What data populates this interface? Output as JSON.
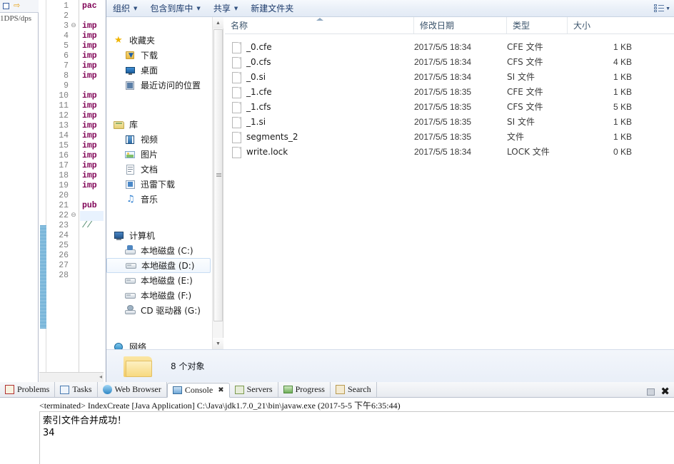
{
  "ide": {
    "breadcrumb": "1DPS/dps",
    "left_tab_icons": [
      "package-explorer-icon",
      "forward-arrow-icon"
    ],
    "editor": {
      "lines": [
        {
          "no": "1",
          "text": "pac",
          "kind": "kw",
          "fold": ""
        },
        {
          "no": "2",
          "text": "",
          "kind": "",
          "fold": ""
        },
        {
          "no": "3",
          "text": "imp",
          "kind": "kw",
          "fold": "⊖"
        },
        {
          "no": "4",
          "text": "imp",
          "kind": "kw",
          "fold": ""
        },
        {
          "no": "5",
          "text": "imp",
          "kind": "kw",
          "fold": ""
        },
        {
          "no": "6",
          "text": "imp",
          "kind": "kw",
          "fold": ""
        },
        {
          "no": "7",
          "text": "imp",
          "kind": "kw",
          "fold": ""
        },
        {
          "no": "8",
          "text": "imp",
          "kind": "kw",
          "fold": ""
        },
        {
          "no": "9",
          "text": "",
          "kind": "",
          "fold": ""
        },
        {
          "no": "10",
          "text": "imp",
          "kind": "kw",
          "fold": ""
        },
        {
          "no": "11",
          "text": "imp",
          "kind": "kw",
          "fold": ""
        },
        {
          "no": "12",
          "text": "imp",
          "kind": "kw",
          "fold": ""
        },
        {
          "no": "13",
          "text": "imp",
          "kind": "kw",
          "fold": ""
        },
        {
          "no": "14",
          "text": "imp",
          "kind": "kw",
          "fold": ""
        },
        {
          "no": "15",
          "text": "imp",
          "kind": "kw",
          "fold": ""
        },
        {
          "no": "16",
          "text": "imp",
          "kind": "kw",
          "fold": ""
        },
        {
          "no": "17",
          "text": "imp",
          "kind": "kw",
          "fold": ""
        },
        {
          "no": "18",
          "text": "imp",
          "kind": "kw",
          "fold": ""
        },
        {
          "no": "19",
          "text": "imp",
          "kind": "kw",
          "fold": ""
        },
        {
          "no": "20",
          "text": "",
          "kind": "",
          "fold": ""
        },
        {
          "no": "21",
          "text": "pub",
          "kind": "kw",
          "fold": ""
        },
        {
          "no": "22",
          "text": "",
          "kind": "",
          "fold": "⊖"
        },
        {
          "no": "23",
          "text": "//",
          "kind": "cmt",
          "fold": ""
        },
        {
          "no": "24",
          "text": "",
          "kind": "",
          "fold": ""
        },
        {
          "no": "25",
          "text": "",
          "kind": "",
          "fold": ""
        },
        {
          "no": "26",
          "text": "",
          "kind": "",
          "fold": ""
        },
        {
          "no": "27",
          "text": "",
          "kind": "",
          "fold": ""
        },
        {
          "no": "28",
          "text": "",
          "kind": "",
          "fold": ""
        }
      ]
    }
  },
  "explorer": {
    "toolbar": {
      "items": [
        {
          "label": "组织",
          "has_caret": true
        },
        {
          "label": "包含到库中",
          "has_caret": true
        },
        {
          "label": "共享",
          "has_caret": true
        },
        {
          "label": "新建文件夹",
          "has_caret": false
        }
      ],
      "view_caret": "▼"
    },
    "nav": {
      "groups": [
        {
          "label": "收藏夹",
          "icon": "star-icon",
          "children": [
            {
              "label": "下载",
              "icon": "downloads-icon"
            },
            {
              "label": "桌面",
              "icon": "desktop-icon"
            },
            {
              "label": "最近访问的位置",
              "icon": "recent-places-icon"
            }
          ]
        },
        {
          "label": "库",
          "icon": "library-icon",
          "children": [
            {
              "label": "视频",
              "icon": "video-icon"
            },
            {
              "label": "图片",
              "icon": "pictures-icon"
            },
            {
              "label": "文档",
              "icon": "documents-icon"
            },
            {
              "label": "迅雷下载",
              "icon": "thunder-download-icon"
            },
            {
              "label": "音乐",
              "icon": "music-icon"
            }
          ]
        },
        {
          "label": "计算机",
          "icon": "computer-icon",
          "children": [
            {
              "label": "本地磁盘 (C:)",
              "icon": "system-drive-icon",
              "selected": false
            },
            {
              "label": "本地磁盘 (D:)",
              "icon": "drive-icon",
              "selected": true
            },
            {
              "label": "本地磁盘 (E:)",
              "icon": "drive-icon",
              "selected": false
            },
            {
              "label": "本地磁盘 (F:)",
              "icon": "drive-icon",
              "selected": false
            },
            {
              "label": "CD 驱动器 (G:)",
              "icon": "cd-drive-icon",
              "selected": false
            }
          ]
        },
        {
          "label": "网络",
          "icon": "network-icon",
          "children": []
        }
      ]
    },
    "list": {
      "columns": [
        {
          "label": "名称",
          "key": "name"
        },
        {
          "label": "修改日期",
          "key": "date"
        },
        {
          "label": "类型",
          "key": "type"
        },
        {
          "label": "大小",
          "key": "size"
        }
      ],
      "sorted_column": "name",
      "sort_direction": "asc",
      "rows": [
        {
          "name": "_0.cfe",
          "date": "2017/5/5 18:34",
          "type": "CFE 文件",
          "size": "1 KB"
        },
        {
          "name": "_0.cfs",
          "date": "2017/5/5 18:34",
          "type": "CFS 文件",
          "size": "4 KB"
        },
        {
          "name": "_0.si",
          "date": "2017/5/5 18:34",
          "type": "SI 文件",
          "size": "1 KB"
        },
        {
          "name": "_1.cfe",
          "date": "2017/5/5 18:35",
          "type": "CFE 文件",
          "size": "1 KB"
        },
        {
          "name": "_1.cfs",
          "date": "2017/5/5 18:35",
          "type": "CFS 文件",
          "size": "5 KB"
        },
        {
          "name": "_1.si",
          "date": "2017/5/5 18:35",
          "type": "SI 文件",
          "size": "1 KB"
        },
        {
          "name": "segments_2",
          "date": "2017/5/5 18:35",
          "type": "文件",
          "size": "1 KB"
        },
        {
          "name": "write.lock",
          "date": "2017/5/5 18:34",
          "type": "LOCK 文件",
          "size": "0 KB"
        }
      ]
    },
    "status": {
      "icon": "folder-icon",
      "text": "8 个对象"
    }
  },
  "console_panel": {
    "tabs": [
      {
        "label": "Problems",
        "icon": "problems-icon",
        "active": false,
        "closable": false
      },
      {
        "label": "Tasks",
        "icon": "tasks-icon",
        "active": false,
        "closable": false
      },
      {
        "label": "Web Browser",
        "icon": "web-browser-icon",
        "active": false,
        "closable": false
      },
      {
        "label": "Console",
        "icon": "console-icon",
        "active": true,
        "closable": true
      },
      {
        "label": "Servers",
        "icon": "servers-icon",
        "active": false,
        "closable": false
      },
      {
        "label": "Progress",
        "icon": "progress-icon",
        "active": false,
        "closable": false
      },
      {
        "label": "Search",
        "icon": "search-icon",
        "active": false,
        "closable": false
      }
    ],
    "tab_close_glyph": "✖",
    "minimize_icon": "minimize-icon",
    "close_icon": "close-icon",
    "close_glyph": "✖",
    "launch_info": "<terminated> IndexCreate [Java Application] C:\\Java\\jdk1.7.0_21\\bin\\javaw.exe (2017-5-5 下午6:35:44)",
    "output_lines": [
      "索引文件合并成功！",
      "34"
    ]
  },
  "colors": {
    "toolbar_text": "#1b3a6b",
    "header_text": "#3a536b",
    "selection_blue": "#5ba3d0",
    "keyword_purple": "#7f0055",
    "comment_green": "#3f7f5f"
  }
}
